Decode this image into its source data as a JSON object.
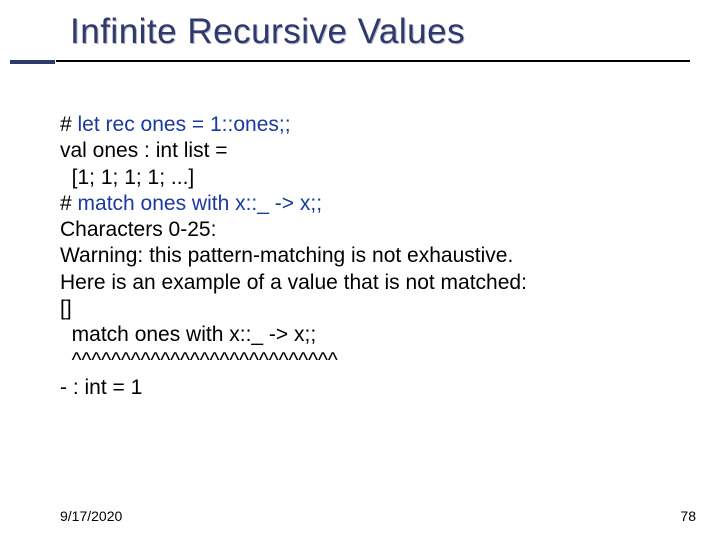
{
  "title": "Infinite Recursive Values",
  "lines": {
    "l0a": "# ",
    "l0b": "let rec ones = 1::ones;;",
    "l1": "val ones : int list =",
    "l2": "  [1; 1; 1; 1; ...]",
    "l3a": "# ",
    "l3b": "match ones with x::_ -> x;;",
    "l4": "Characters 0-25:",
    "l5": "Warning: this pattern-matching is not exhaustive.",
    "l6": "Here is an example of a value that is not matched:",
    "l7": "[]",
    "l8": "  match ones with x::_ -> x;;",
    "l9": "  ^^^^^^^^^^^^^^^^^^^^^^^^^^^",
    "l10": "- : int = 1"
  },
  "footer": {
    "date": "9/17/2020",
    "page": "78"
  }
}
